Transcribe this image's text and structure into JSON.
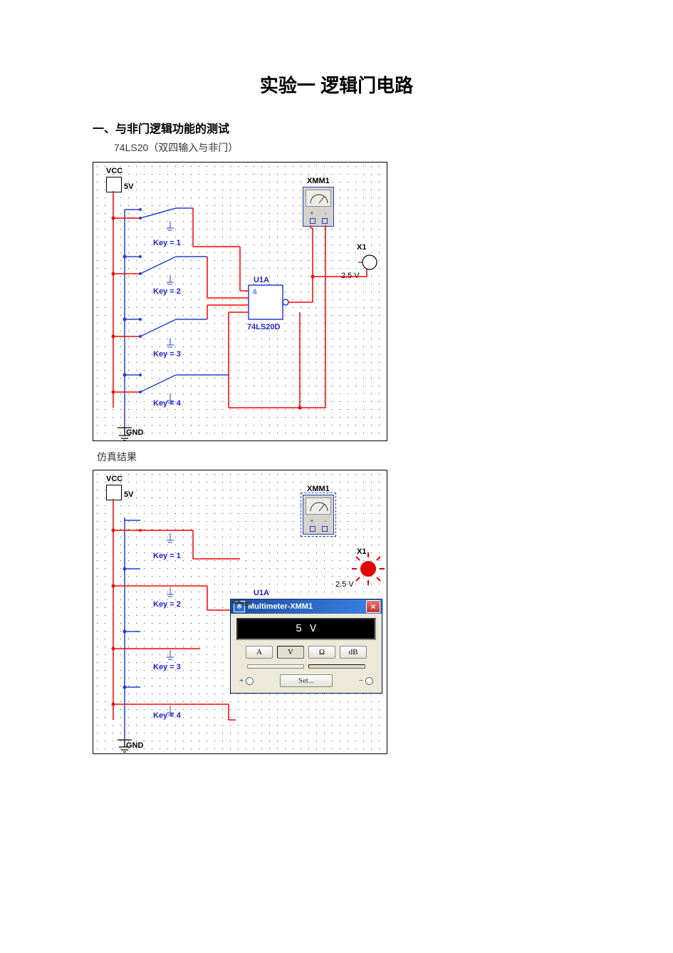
{
  "document": {
    "title": "实验一  逻辑门电路",
    "section1_heading": "一、与非门逻辑功能的测试",
    "chip_desc": "74LS20（双四输入与非门）",
    "sim_result_label": "仿真结果"
  },
  "circuit": {
    "vcc": "VCC",
    "vcc_val": "5V",
    "gnd": "GND",
    "key1": "Key = 1",
    "key2": "Key = 2",
    "key3": "Key = 3",
    "key4": "Key = 4",
    "gate_ref": "U1A",
    "gate_part": "74LS20D",
    "xmm_ref": "XMM1",
    "probe_ref": "X1",
    "probe_val": "2.5 V"
  },
  "multimeter": {
    "window_title": "Multimeter-XMM1",
    "reading": "5 V",
    "btn_A": "A",
    "btn_V": "V",
    "btn_ohm": "Ω",
    "btn_dB": "dB",
    "btn_ac": "∿",
    "btn_dc": "⎓",
    "btn_set": "Set...",
    "term_plus": "+",
    "term_minus": "−"
  }
}
